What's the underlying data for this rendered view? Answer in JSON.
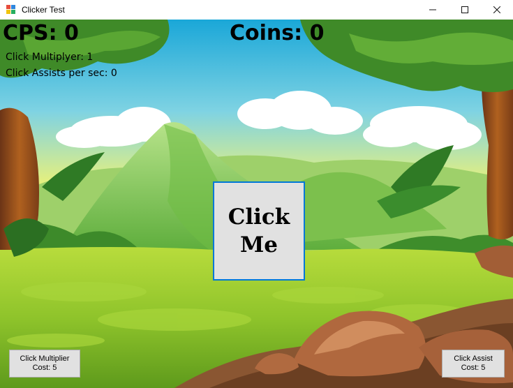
{
  "window": {
    "title": "Clicker Test",
    "minimize": "–",
    "maximize": "☐",
    "close": "✕"
  },
  "hud": {
    "cps": "CPS: 0",
    "coins": "Coins: 0",
    "multiplier": "Click Multiplyer: 1",
    "assists": "Click Assists per sec: 0"
  },
  "click_button": {
    "line1": "Click",
    "line2": "Me"
  },
  "shop": {
    "multiplier": {
      "label": "Click Multiplier",
      "cost": "Cost: 5"
    },
    "assist": {
      "label": "Click Assist",
      "cost": "Cost: 5"
    }
  }
}
